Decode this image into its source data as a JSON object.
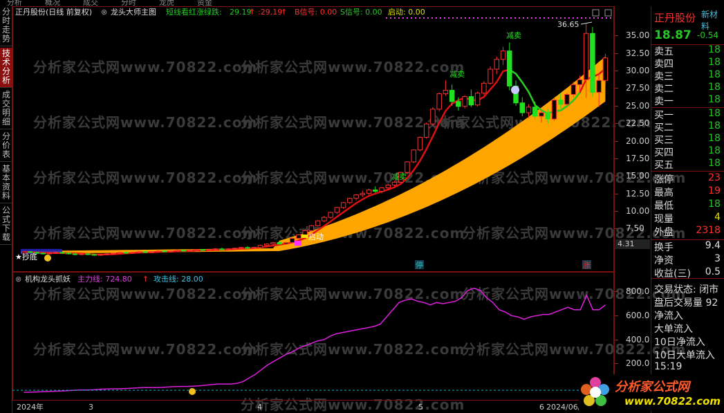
{
  "top_strip": [
    "分析",
    "概况",
    "成交",
    "分时",
    "龙虎",
    "资金"
  ],
  "sidebar_tabs": [
    {
      "label": "分时走势",
      "active": false
    },
    {
      "label": "技术分析",
      "active": true
    },
    {
      "label": "成交明细",
      "active": false
    },
    {
      "label": "分价表",
      "active": false
    },
    {
      "label": "基本资料",
      "active": false
    },
    {
      "label": "公式下载",
      "active": false
    }
  ],
  "main_header": {
    "stock": "正丹股份(日线 前复权)",
    "indicator": "龙头大师主图",
    "line1_label": "短线看红涨绿跌:",
    "line1_value": "29.19",
    "line2_value": ":29.19",
    "b_signal": "B信号: 0.00",
    "s_signal": "S信号: 0.00",
    "start_label": "启动: 0.00"
  },
  "price_axis": [
    "35.00",
    "32.50",
    "30.00",
    "27.50",
    "25.00",
    "22.50",
    "20.00",
    "17.50",
    "15.00",
    "12.50",
    "10.00",
    "7.50"
  ],
  "current_price_tag": "4.31",
  "high_label": "36.65",
  "annotations": {
    "reduce": "减卖",
    "start": "启动",
    "bottom": "★抄底",
    "stop_badge": "停",
    "rise_badge": "涨"
  },
  "sub_header": {
    "name": "机构龙头抓妖",
    "main_label": "主力线: 724.80",
    "attack_label": "攻击线: 28.00"
  },
  "sub_axis": [
    "800.0",
    "600.0",
    "400.0",
    "200.0"
  ],
  "date_axis": [
    "2024年",
    "3",
    "4",
    "5",
    "6",
    "2024/06/"
  ],
  "watermark": "分析家公式网www.70822.com",
  "right_panel": {
    "name": "正丹股份",
    "tag": "新材料",
    "price": "18.87",
    "change": "-0.54",
    "sells": [
      {
        "label": "卖五",
        "value": "18"
      },
      {
        "label": "卖四",
        "value": "18"
      },
      {
        "label": "卖三",
        "value": "18"
      },
      {
        "label": "卖二",
        "value": "18"
      },
      {
        "label": "卖一",
        "value": "18"
      }
    ],
    "buys": [
      {
        "label": "买一",
        "value": "18"
      },
      {
        "label": "买二",
        "value": "18"
      },
      {
        "label": "买三",
        "value": "18"
      },
      {
        "label": "买四",
        "value": "18"
      },
      {
        "label": "买五",
        "value": "18"
      }
    ],
    "stats": [
      {
        "label": "涨停",
        "value": "23",
        "color": "#ff3030"
      },
      {
        "label": "最高",
        "value": "19",
        "color": "#ff3030"
      },
      {
        "label": "最低",
        "value": "18",
        "color": "#25c825"
      },
      {
        "label": "现量",
        "value": "4",
        "color": "#e0e000"
      },
      {
        "label": "外盘",
        "value": "2318",
        "color": "#ff3030"
      }
    ],
    "stats2": [
      {
        "label": "换手",
        "value": "9.4",
        "color": "#e0e0e0"
      },
      {
        "label": "净资",
        "value": "3",
        "color": "#e0e0e0"
      },
      {
        "label": "收益(三)",
        "value": "0.5",
        "color": "#e0e0e0"
      }
    ],
    "status": [
      "交易状态: 闭市",
      "盘后交易量 92",
      "净流入",
      "大单流入",
      "10日净流入",
      "10日大单流入",
      "15:19"
    ]
  },
  "logo": {
    "text": "分析家公式网",
    "url": "www.70822.com"
  },
  "chart_data": {
    "type": "candlestick",
    "ylim": [
      3.5,
      37
    ],
    "note_axis": "price",
    "candles": [
      [
        4.0,
        4.3,
        3.9,
        4.2
      ],
      [
        4.2,
        4.3,
        4.0,
        4.1
      ],
      [
        4.1,
        4.2,
        3.9,
        4.0
      ],
      [
        4.0,
        4.1,
        3.8,
        3.9
      ],
      [
        3.9,
        4.1,
        3.8,
        4.0
      ],
      [
        4.0,
        4.2,
        3.9,
        4.1
      ],
      [
        4.1,
        4.2,
        3.9,
        4.0
      ],
      [
        4.0,
        4.1,
        3.8,
        3.9
      ],
      [
        3.9,
        4.0,
        3.7,
        3.8
      ],
      [
        3.8,
        4.0,
        3.7,
        3.9
      ],
      [
        3.9,
        4.0,
        3.7,
        3.8
      ],
      [
        3.8,
        3.9,
        3.6,
        3.7
      ],
      [
        3.7,
        3.9,
        3.6,
        3.8
      ],
      [
        3.8,
        4.0,
        3.7,
        3.9
      ],
      [
        3.9,
        4.1,
        3.8,
        4.0
      ],
      [
        4.0,
        4.2,
        3.9,
        4.1
      ],
      [
        4.1,
        4.2,
        3.9,
        4.0
      ],
      [
        4.0,
        4.2,
        3.9,
        4.1
      ],
      [
        4.1,
        4.3,
        4.0,
        4.2
      ],
      [
        4.2,
        4.3,
        4.0,
        4.1
      ],
      [
        4.1,
        4.3,
        4.0,
        4.2
      ],
      [
        4.2,
        4.4,
        4.1,
        4.3
      ],
      [
        4.3,
        4.4,
        4.1,
        4.2
      ],
      [
        4.2,
        4.4,
        4.1,
        4.3
      ],
      [
        4.3,
        4.5,
        4.2,
        4.4
      ],
      [
        4.4,
        4.5,
        4.2,
        4.3
      ],
      [
        4.3,
        4.5,
        4.2,
        4.4
      ],
      [
        4.4,
        4.6,
        4.3,
        4.5
      ],
      [
        4.5,
        4.6,
        4.3,
        4.4
      ],
      [
        4.4,
        4.6,
        4.3,
        4.5
      ],
      [
        4.5,
        4.7,
        4.4,
        4.6
      ],
      [
        4.6,
        4.8,
        4.4,
        4.5
      ],
      [
        4.5,
        4.7,
        4.4,
        4.6
      ],
      [
        4.6,
        4.8,
        4.5,
        4.7
      ],
      [
        4.7,
        4.9,
        4.5,
        4.8
      ],
      [
        4.8,
        5.0,
        4.6,
        4.7
      ],
      [
        4.7,
        4.9,
        4.6,
        4.8
      ],
      [
        4.8,
        5.2,
        4.7,
        5.1
      ],
      [
        5.1,
        5.4,
        5.0,
        5.3
      ],
      [
        5.3,
        5.6,
        5.1,
        5.5
      ],
      [
        5.5,
        5.7,
        5.2,
        5.3
      ],
      [
        5.3,
        5.6,
        5.2,
        5.5
      ],
      [
        5.5,
        6.2,
        5.4,
        6.1
      ],
      [
        6.1,
        6.7,
        6.0,
        6.6
      ],
      [
        6.6,
        7.3,
        6.5,
        7.2
      ],
      [
        7.2,
        8.0,
        7.1,
        7.9
      ],
      [
        7.9,
        8.7,
        7.8,
        8.6
      ],
      [
        8.6,
        9.3,
        8.4,
        9.1
      ],
      [
        9.1,
        9.9,
        8.9,
        9.8
      ],
      [
        9.8,
        10.6,
        9.6,
        10.5
      ],
      [
        10.5,
        11.3,
        10.3,
        11.2
      ],
      [
        11.2,
        11.9,
        11.0,
        11.8
      ],
      [
        11.8,
        12.4,
        11.5,
        12.3
      ],
      [
        12.3,
        12.9,
        12.0,
        12.5
      ],
      [
        12.5,
        13.2,
        12.3,
        13.0
      ],
      [
        13.0,
        13.5,
        12.6,
        12.8
      ],
      [
        12.8,
        13.4,
        12.5,
        13.3
      ],
      [
        13.3,
        13.9,
        13.0,
        13.7
      ],
      [
        13.7,
        14.3,
        13.5,
        14.1
      ],
      [
        14.1,
        15.6,
        14.0,
        15.5
      ],
      [
        15.5,
        17.1,
        15.3,
        17.0
      ],
      [
        17.0,
        18.8,
        16.8,
        18.7
      ],
      [
        18.7,
        20.6,
        18.5,
        20.5
      ],
      [
        20.5,
        22.6,
        20.3,
        22.4
      ],
      [
        22.4,
        24.8,
        22.1,
        24.5
      ],
      [
        24.5,
        26.9,
        24.2,
        26.7
      ],
      [
        26.7,
        28.6,
        26.4,
        27.2
      ],
      [
        27.2,
        28.0,
        25.0,
        25.6
      ],
      [
        25.6,
        26.2,
        24.3,
        24.9
      ],
      [
        24.9,
        26.5,
        24.6,
        26.3
      ],
      [
        26.3,
        27.3,
        24.8,
        25.1
      ],
      [
        25.1,
        27.0,
        24.9,
        26.8
      ],
      [
        26.8,
        28.5,
        26.5,
        28.2
      ],
      [
        28.2,
        30.6,
        28.0,
        30.2
      ],
      [
        30.2,
        32.0,
        29.5,
        31.6
      ],
      [
        31.6,
        33.4,
        30.8,
        32.8
      ],
      [
        32.8,
        34.0,
        27.2,
        27.8
      ],
      [
        27.8,
        28.6,
        25.0,
        25.4
      ],
      [
        25.4,
        26.2,
        23.5,
        24.0
      ],
      [
        24.0,
        25.2,
        23.2,
        24.8
      ],
      [
        24.8,
        25.6,
        23.0,
        23.5
      ],
      [
        23.5,
        24.4,
        22.6,
        24.0
      ],
      [
        24.0,
        24.5,
        22.5,
        23.1
      ],
      [
        23.1,
        26.2,
        22.8,
        25.8
      ],
      [
        25.8,
        26.8,
        24.6,
        25.2
      ],
      [
        25.2,
        26.8,
        25.0,
        26.6
      ],
      [
        26.6,
        28.4,
        26.2,
        28.0
      ],
      [
        28.0,
        29.3,
        27.0,
        28.7
      ],
      [
        28.7,
        36.65,
        26.1,
        35.3
      ],
      [
        35.3,
        36.2,
        26.3,
        26.9
      ],
      [
        26.9,
        29.6,
        24.8,
        28.6
      ],
      [
        28.6,
        32.4,
        27.7,
        31.8
      ]
    ],
    "main_curve_sample": [
      4.0,
      4.1,
      4.2,
      4.3,
      4.6,
      5.6,
      7.8,
      10.8,
      14.5,
      19.2,
      23.9,
      26.0,
      24.3,
      25.3,
      27.0,
      28.7
    ],
    "sub_series": {
      "name": "主力线",
      "ylim": [
        0,
        900
      ],
      "values": [
        10,
        12,
        14,
        16,
        18,
        20,
        22,
        25,
        28,
        30,
        30,
        32,
        35,
        38,
        40,
        40,
        42,
        45,
        48,
        50,
        50,
        50,
        52,
        55,
        58,
        60,
        60,
        62,
        65,
        70,
        75,
        80,
        80,
        80,
        85,
        100,
        130,
        160,
        200,
        240,
        270,
        300,
        330,
        350,
        380,
        400,
        420,
        440,
        450,
        480,
        500,
        510,
        520,
        530,
        540,
        550,
        560,
        580,
        640,
        700,
        760,
        780,
        790,
        770,
        760,
        740,
        760,
        750,
        760,
        770,
        800,
        860,
        880,
        860,
        800,
        760,
        700,
        680,
        650,
        640,
        620,
        640,
        650,
        660,
        660,
        680,
        700,
        720,
        700,
        700,
        820,
        700,
        700,
        740
      ]
    }
  }
}
